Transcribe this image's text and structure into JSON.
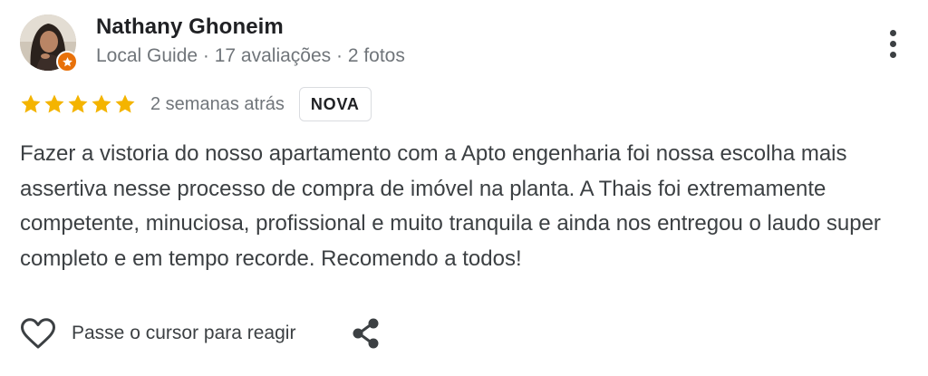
{
  "reviewer": {
    "name": "Nathany Ghoneim",
    "meta": "Local Guide · 17 avaliações · 2 fotos",
    "badge_icon": "local-guide-star-icon"
  },
  "review": {
    "rating": 5,
    "rating_max": 5,
    "date": "2 semanas atrás",
    "badge": "NOVA",
    "text": "Fazer a vistoria do nosso apartamento com a Apto engenharia foi nossa escolha mais assertiva nesse processo de compra de imóvel na planta. A Thais foi extremamente competente, minuciosa, profissional e muito tranquila e ainda nos entregou o laudo super completo e em tempo recorde. Recomendo a todos!"
  },
  "actions": {
    "react_label": "Passe o cursor para reagir",
    "like_icon": "heart-outline-icon",
    "share_icon": "share-icon",
    "more_icon": "more-vertical-icon"
  },
  "colors": {
    "star": "#f4b400",
    "badge": "#e8710a",
    "text": "#3c4043",
    "muted": "#70757a"
  }
}
